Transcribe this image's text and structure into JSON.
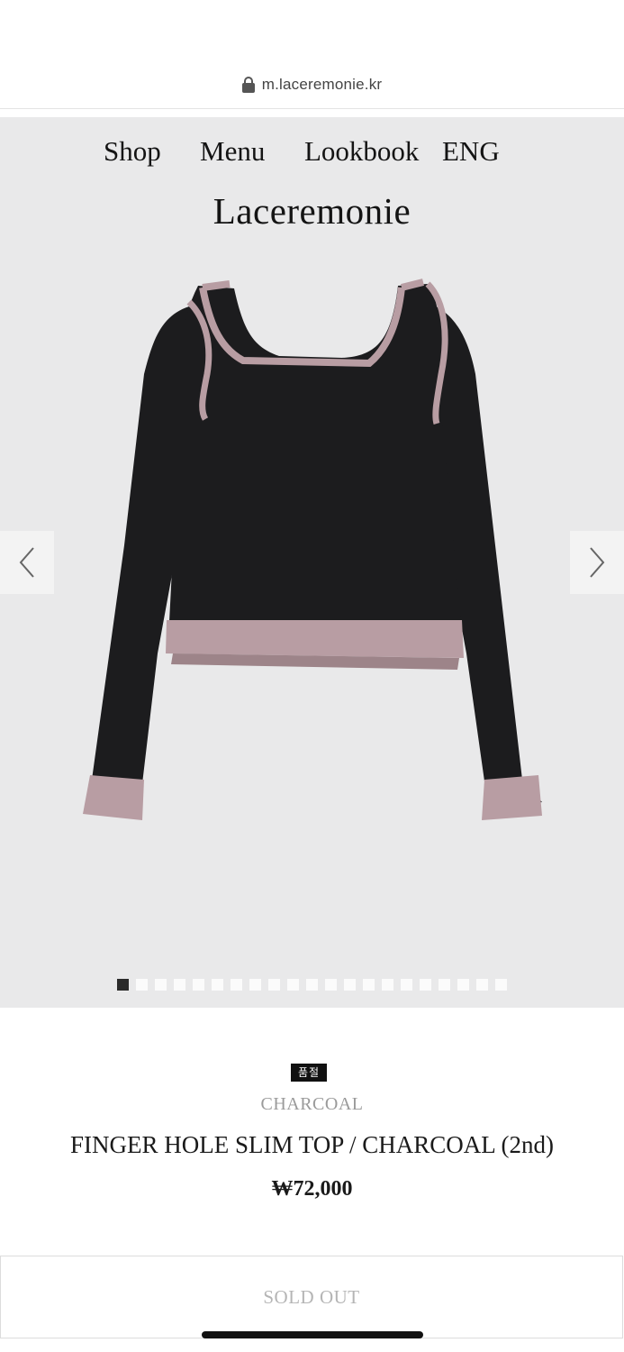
{
  "browser": {
    "url": "m.laceremonie.kr"
  },
  "nav": {
    "shop": "Shop",
    "menu": "Menu",
    "lookbook": "Lookbook",
    "lang": "ENG"
  },
  "brand": "Laceremonie",
  "gallery": {
    "total_images": 21,
    "current_index": 1
  },
  "product": {
    "badge": "품절",
    "color": "CHARCOAL",
    "title": "FINGER HOLE SLIM TOP / CHARCOAL (2nd)",
    "price": "₩72,000"
  },
  "buttons": {
    "soldout": "SOLD OUT"
  },
  "colors": {
    "hero_bg": "#e9e9ea",
    "garment": "#1c1c1e",
    "trim": "#b89da3"
  }
}
